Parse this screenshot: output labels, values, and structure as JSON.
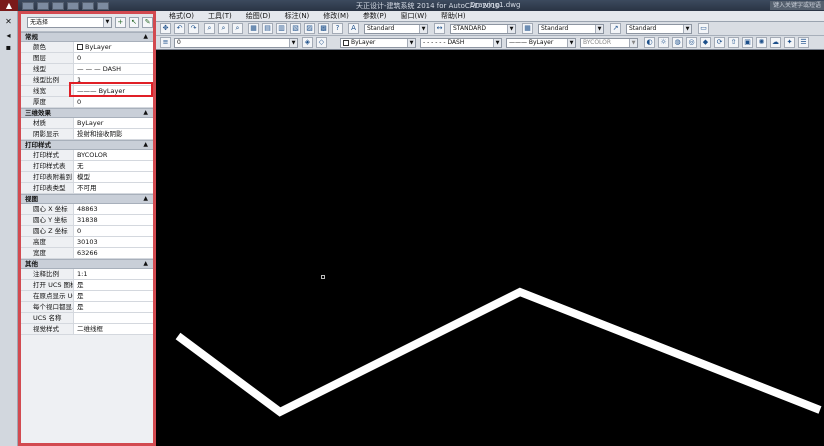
{
  "titlebar": {
    "title": "天正设计-建筑系统 2014 for AutoCAD 2010",
    "doc": "Drawing1.dwg",
    "search_placeholder": "键入关键字或短语"
  },
  "menubar": {
    "items": [
      "格式(O)",
      "工具(T)",
      "绘图(D)",
      "标注(N)",
      "修改(M)",
      "参数(P)",
      "窗口(W)",
      "帮助(H)"
    ]
  },
  "toolbar": {
    "text_style": "Standard",
    "dim_style": "STANDARD",
    "table_style": "Standard",
    "multileader_style": "Standard",
    "layer_value": "0",
    "color_value": "ByLayer",
    "linetype_value": "DASH",
    "lineweight_value": "ByLayer",
    "plotstyle_value": "BYCOLOR"
  },
  "palette": {
    "selection": "无选择",
    "sections": [
      {
        "title": "常规",
        "rows": [
          {
            "key": "颜色",
            "value": "ByLayer"
          },
          {
            "key": "图层",
            "value": "0"
          },
          {
            "key": "线型",
            "value": "— — — DASH"
          },
          {
            "key": "线型比例",
            "value": "1"
          },
          {
            "key": "线宽",
            "value": "——— ByLayer"
          },
          {
            "key": "厚度",
            "value": "0"
          }
        ]
      },
      {
        "title": "三维效果",
        "rows": [
          {
            "key": "材质",
            "value": "ByLayer"
          },
          {
            "key": "阴影显示",
            "value": "投射和接收阴影"
          }
        ]
      },
      {
        "title": "打印样式",
        "rows": [
          {
            "key": "打印样式",
            "value": "BYCOLOR"
          },
          {
            "key": "打印样式表",
            "value": "无"
          },
          {
            "key": "打印表附着到",
            "value": "模型"
          },
          {
            "key": "打印表类型",
            "value": "不可用"
          }
        ]
      },
      {
        "title": "视图",
        "rows": [
          {
            "key": "圆心 X 坐标",
            "value": "48863"
          },
          {
            "key": "圆心 Y 坐标",
            "value": "31838"
          },
          {
            "key": "圆心 Z 坐标",
            "value": "0"
          },
          {
            "key": "高度",
            "value": "30103"
          },
          {
            "key": "宽度",
            "value": "63266"
          }
        ]
      },
      {
        "title": "其他",
        "rows": [
          {
            "key": "注释比例",
            "value": "1:1"
          },
          {
            "key": "打开 UCS 图标",
            "value": "是"
          },
          {
            "key": "在原点显示 UC...",
            "value": "是"
          },
          {
            "key": "每个视口都显...",
            "value": "是"
          },
          {
            "key": "UCS 名称",
            "value": ""
          },
          {
            "key": "视觉样式",
            "value": "二维线框"
          }
        ]
      }
    ]
  },
  "colors": {
    "highlight": "#e01f26",
    "palette_border": "#d24a50",
    "polyline": "#ffffff"
  }
}
